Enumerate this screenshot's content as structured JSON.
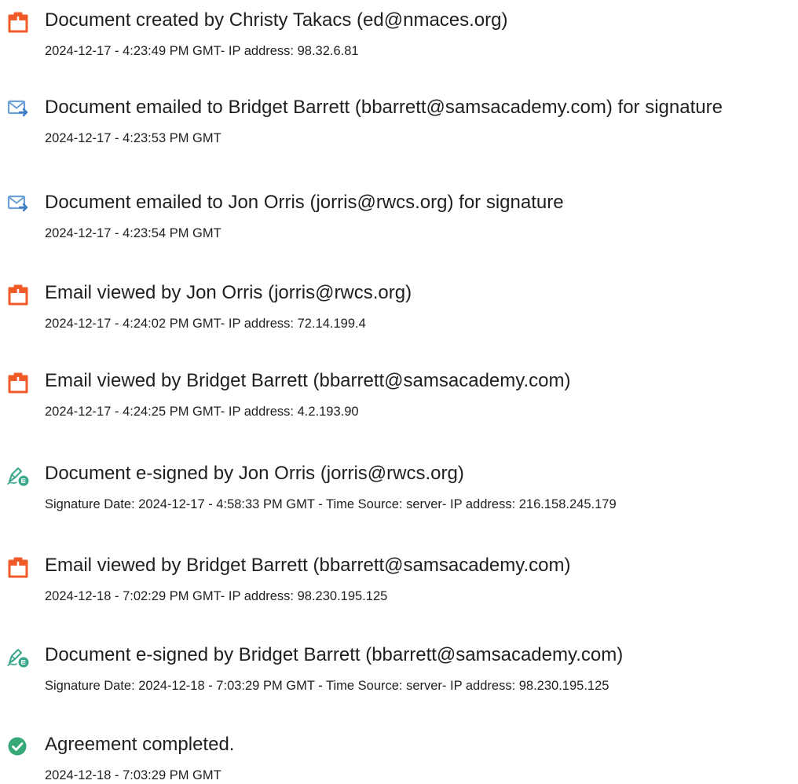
{
  "events": [
    {
      "icon": "document-created-icon",
      "title": "Document created by Christy Takacs (ed@nmaces.org)",
      "detail": "2024-12-17 - 4:23:49 PM GMT- IP address: 98.32.6.81"
    },
    {
      "icon": "email-sent-icon",
      "title": "Document emailed to Bridget Barrett (bbarrett@samsacademy.com) for signature",
      "detail": "2024-12-17 - 4:23:53 PM GMT"
    },
    {
      "icon": "email-sent-icon",
      "title": "Document emailed to Jon Orris (jorris@rwcs.org) for signature",
      "detail": "2024-12-17 - 4:23:54 PM GMT"
    },
    {
      "icon": "document-viewed-icon",
      "title": "Email viewed by Jon Orris (jorris@rwcs.org)",
      "detail": "2024-12-17 - 4:24:02 PM GMT- IP address: 72.14.199.4"
    },
    {
      "icon": "document-viewed-icon",
      "title": "Email viewed by Bridget Barrett (bbarrett@samsacademy.com)",
      "detail": "2024-12-17 - 4:24:25 PM GMT- IP address: 4.2.193.90"
    },
    {
      "icon": "e-sign-icon",
      "title": "Document e-signed by Jon Orris (jorris@rwcs.org)",
      "detail": "Signature Date: 2024-12-17 - 4:58:33 PM GMT - Time Source: server- IP address: 216.158.245.179"
    },
    {
      "icon": "document-viewed-icon",
      "title": "Email viewed by Bridget Barrett (bbarrett@samsacademy.com)",
      "detail": "2024-12-18 - 7:02:29 PM GMT- IP address: 98.230.195.125"
    },
    {
      "icon": "e-sign-icon",
      "title": "Document e-signed by Bridget Barrett (bbarrett@samsacademy.com)",
      "detail": "Signature Date: 2024-12-18 - 7:03:29 PM GMT - Time Source: server- IP address: 98.230.195.125"
    },
    {
      "icon": "agreement-completed-icon",
      "title": "Agreement completed.",
      "detail": "2024-12-18 - 7:03:29 PM GMT"
    }
  ],
  "colors": {
    "document_icon": "#f05a28",
    "email_icon": "#6aa0d6",
    "sign_icon": "#3aa68c",
    "complete_icon": "#34a877",
    "text": "#1f1f1f"
  }
}
